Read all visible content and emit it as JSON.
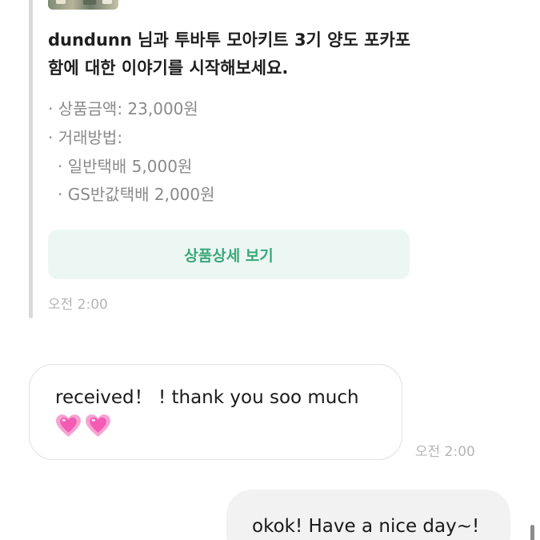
{
  "system_card": {
    "heading": "dundunn 님과 투바투 모아키트 3기 양도 포카포함에 대한 이야기를 시작해보세요.",
    "price": "· 상품금액: 23,000원",
    "method": "· 거래방법:",
    "shipping_options": [
      "· 일반택배 5,000원",
      "· GS반값택배 2,000원"
    ],
    "detail_button": "상품상세 보기",
    "time": "오전 2:00"
  },
  "received_message": {
    "text": "received！ ! thank you soo much",
    "emoji": "💗💗",
    "time": "오전 2:00"
  },
  "sent_message": {
    "text": "okok! Have a nice day~!"
  },
  "colors": {
    "detail_button_bg": "#ecf7f3",
    "detail_button_text": "#3aa77a",
    "sent_bubble_bg": "#f2f2f2",
    "received_bubble_border": "#e1e1e1",
    "heart": "#f45bb3"
  },
  "icons": {
    "heart": "growing-heart-icon",
    "product": "product-thumbnail"
  }
}
